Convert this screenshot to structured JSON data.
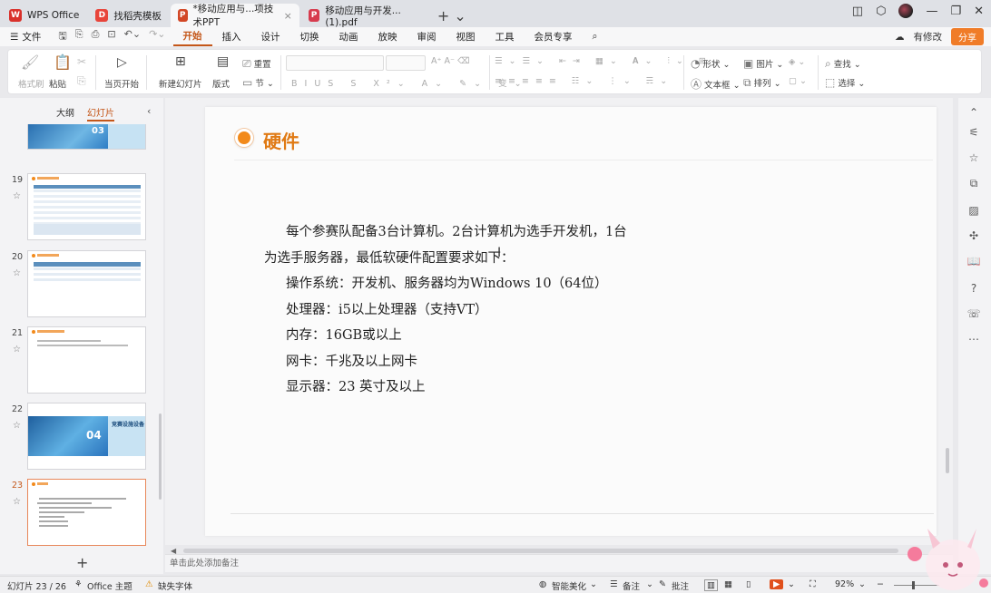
{
  "titlebar": {
    "tabs": [
      {
        "label": "WPS Office",
        "icon": "wps-logo-icon",
        "color": "#d9312b"
      },
      {
        "label": "找稻壳模板",
        "icon": "docer-icon",
        "color": "#e8443a"
      },
      {
        "label": "*移动应用与...项技术PPT",
        "icon": "ppt-icon",
        "color": "#d24726",
        "close": "×"
      },
      {
        "label": "移动应用与开发...(1).pdf",
        "icon": "pdf-icon",
        "color": "#d73b4e"
      }
    ],
    "new_tab": "+ ⌄"
  },
  "menu": {
    "file": "文件",
    "items": [
      "开始",
      "插入",
      "设计",
      "切换",
      "动画",
      "放映",
      "审阅",
      "视图",
      "工具",
      "会员专享"
    ],
    "active": "开始",
    "modified": "有修改",
    "share": "分享"
  },
  "ribbon": {
    "format_painter": "格式刷",
    "paste": "粘贴",
    "from_start": "当页开始",
    "new_slide": "新建幻灯片",
    "layout": "版式",
    "reset": "重置",
    "section": "节",
    "shape": "形状",
    "picture": "图片",
    "textbox": "文本框",
    "arrange": "排列",
    "find": "查找",
    "select": "选择"
  },
  "panel": {
    "tab_outline": "大纲",
    "tab_slides": "幻灯片",
    "slides": [
      {
        "num": "19"
      },
      {
        "num": "20"
      },
      {
        "num": "21"
      },
      {
        "num": "22",
        "section_num": "04",
        "section_title": "竞赛设施设备"
      },
      {
        "num": "23"
      }
    ],
    "partial_section_num": "03"
  },
  "slide": {
    "title": "硬件",
    "lines": [
      "每个参赛队配备3台计算机。2台计算机为选手开发机，1台",
      "为选手服务器，最低软硬件配置要求如下：",
      "操作系统：开发机、服务器均为Windows 10（64位）",
      "处理器：i5以上处理器（支持VT）",
      "内存：16GB或以上",
      "网卡：千兆及以上网卡",
      "显示器：23 英寸及以上"
    ]
  },
  "notes_placeholder": "单击此处添加备注",
  "status": {
    "slide_counter": "幻灯片 23 / 26",
    "theme": "Office 主题",
    "missing_font": "缺失字体",
    "smart_beautify": "智能美化",
    "notes": "备注",
    "comments": "批注",
    "zoom": "92%"
  }
}
